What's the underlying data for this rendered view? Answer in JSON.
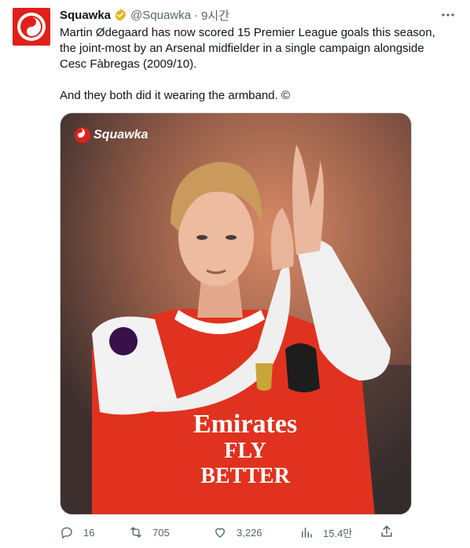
{
  "tweet": {
    "author_name": "Squawka",
    "handle": "@Squawka",
    "separator": "·",
    "time": "9시간",
    "text": "Martin Ødegaard has now scored 15 Premier League goals this season, the joint-most by an Arsenal midfielder in a single campaign alongside Cesc Fàbregas (2009/10).\n\nAnd they both did it wearing the armband. ©",
    "media_watermark": "Squawka",
    "jersey_sponsor_line1": "Emirates",
    "jersey_sponsor_line2": "FLY BETTER"
  },
  "actions": {
    "replies": "16",
    "retweets": "705",
    "likes": "3,226",
    "views": "15.4만"
  },
  "colors": {
    "brand_red": "#e0201b",
    "verified_gold": "#e2b719",
    "secondary_text": "#536471",
    "jersey_red": "#e0321f"
  }
}
